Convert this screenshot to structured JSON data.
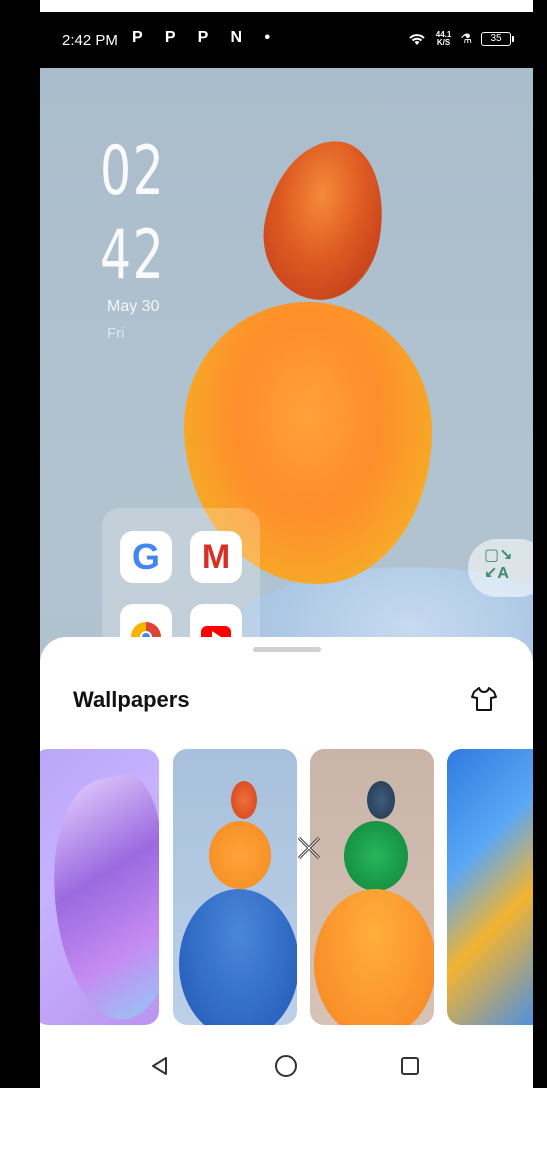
{
  "status_bar": {
    "time": "2:42 PM",
    "notification_icons": "P P P N •",
    "net_speed_value": "44.1",
    "net_speed_unit": "K/S",
    "battery": "35"
  },
  "lock_clock": {
    "hour": "02",
    "minute": "42",
    "date": "May 30",
    "day": "Fri"
  },
  "home_apps": {
    "google_glyph": "G",
    "gmail_glyph": "M",
    "translate_glyph_top": "▢↘",
    "translate_glyph_bottom": "↙A"
  },
  "sheet": {
    "title": "Wallpapers"
  },
  "colors": {
    "accent": "#ff8d2b",
    "sheet_bg": "#ffffff",
    "title": "#111111"
  },
  "icons": {
    "theme": "t-shirt-icon",
    "back": "back-triangle-icon",
    "home": "home-circle-icon",
    "recents": "recents-square-icon",
    "close": "close-x-icon"
  }
}
